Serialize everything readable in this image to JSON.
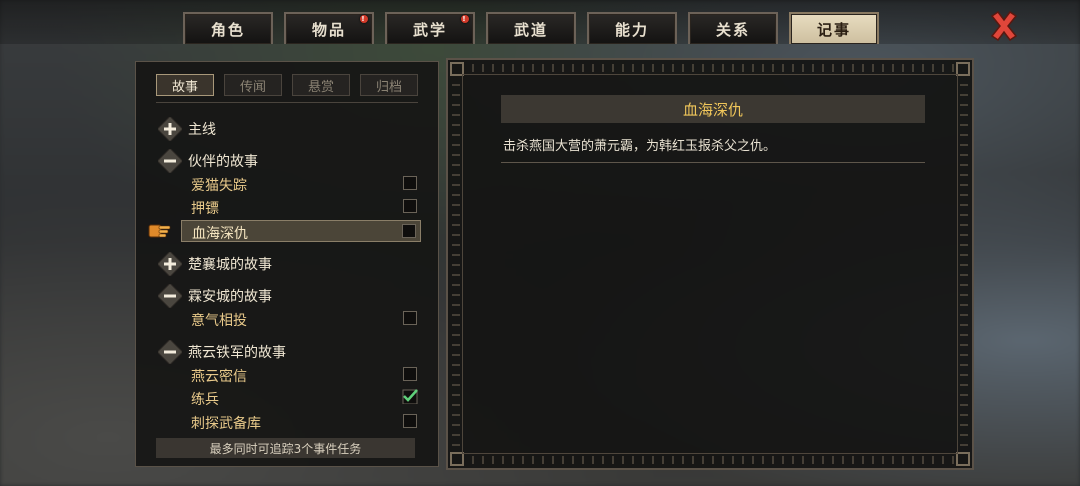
{
  "tabs": [
    {
      "label": "角色",
      "badge": false,
      "active": false
    },
    {
      "label": "物品",
      "badge": true,
      "active": false
    },
    {
      "label": "武学",
      "badge": true,
      "active": false
    },
    {
      "label": "武道",
      "badge": false,
      "active": false
    },
    {
      "label": "能力",
      "badge": false,
      "active": false
    },
    {
      "label": "关系",
      "badge": false,
      "active": false
    },
    {
      "label": "记事",
      "badge": false,
      "active": true
    }
  ],
  "subtabs": [
    {
      "label": "故事",
      "active": true
    },
    {
      "label": "传闻",
      "active": false
    },
    {
      "label": "悬赏",
      "active": false
    },
    {
      "label": "归档",
      "active": false
    }
  ],
  "tree": {
    "main_line": {
      "label": "主线",
      "expanded": false
    },
    "companion": {
      "label": "伙伴的故事",
      "expanded": true,
      "items": [
        {
          "label": "爱猫失踪",
          "checked": false
        },
        {
          "label": "押镖",
          "checked": false
        },
        {
          "label": "血海深仇",
          "checked": false,
          "selected": true
        }
      ]
    },
    "chuxiang": {
      "label": "楚襄城的故事",
      "expanded": false
    },
    "lin_an": {
      "label": "霖安城的故事",
      "expanded": true,
      "items": [
        {
          "label": "意气相投",
          "checked": false
        }
      ]
    },
    "yanyun": {
      "label": "燕云铁军的故事",
      "expanded": true,
      "items": [
        {
          "label": "燕云密信",
          "checked": false
        },
        {
          "label": "练兵",
          "checked": true
        },
        {
          "label": "刺探武备库",
          "checked": false
        }
      ]
    }
  },
  "footer_note": "最多同时可追踪3个事件任务",
  "detail": {
    "title": "血海深仇",
    "description": "击杀燕国大营的萧元霸，为韩红玉报杀父之仇。"
  },
  "colors": {
    "accent_gold": "#f0c65a",
    "item_text": "#e8c98a",
    "badge_red": "#d23a2a",
    "check_green": "#5fd07a",
    "close_red": "#e0463a"
  },
  "icons": [
    "plus-icon",
    "minus-icon",
    "pointer-hand-icon",
    "check-icon",
    "close-icon"
  ]
}
